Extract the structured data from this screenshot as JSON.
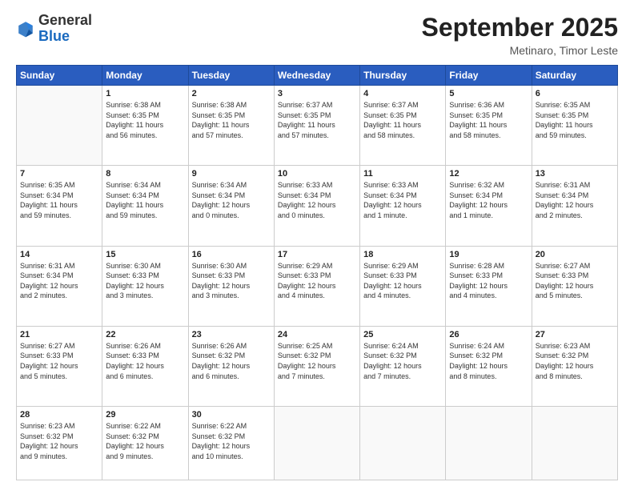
{
  "header": {
    "logo_general": "General",
    "logo_blue": "Blue",
    "month_title": "September 2025",
    "location": "Metinaro, Timor Leste"
  },
  "days_of_week": [
    "Sunday",
    "Monday",
    "Tuesday",
    "Wednesday",
    "Thursday",
    "Friday",
    "Saturday"
  ],
  "weeks": [
    [
      {
        "day": "",
        "info": ""
      },
      {
        "day": "1",
        "info": "Sunrise: 6:38 AM\nSunset: 6:35 PM\nDaylight: 11 hours\nand 56 minutes."
      },
      {
        "day": "2",
        "info": "Sunrise: 6:38 AM\nSunset: 6:35 PM\nDaylight: 11 hours\nand 57 minutes."
      },
      {
        "day": "3",
        "info": "Sunrise: 6:37 AM\nSunset: 6:35 PM\nDaylight: 11 hours\nand 57 minutes."
      },
      {
        "day": "4",
        "info": "Sunrise: 6:37 AM\nSunset: 6:35 PM\nDaylight: 11 hours\nand 58 minutes."
      },
      {
        "day": "5",
        "info": "Sunrise: 6:36 AM\nSunset: 6:35 PM\nDaylight: 11 hours\nand 58 minutes."
      },
      {
        "day": "6",
        "info": "Sunrise: 6:35 AM\nSunset: 6:35 PM\nDaylight: 11 hours\nand 59 minutes."
      }
    ],
    [
      {
        "day": "7",
        "info": "Sunrise: 6:35 AM\nSunset: 6:34 PM\nDaylight: 11 hours\nand 59 minutes."
      },
      {
        "day": "8",
        "info": "Sunrise: 6:34 AM\nSunset: 6:34 PM\nDaylight: 11 hours\nand 59 minutes."
      },
      {
        "day": "9",
        "info": "Sunrise: 6:34 AM\nSunset: 6:34 PM\nDaylight: 12 hours\nand 0 minutes."
      },
      {
        "day": "10",
        "info": "Sunrise: 6:33 AM\nSunset: 6:34 PM\nDaylight: 12 hours\nand 0 minutes."
      },
      {
        "day": "11",
        "info": "Sunrise: 6:33 AM\nSunset: 6:34 PM\nDaylight: 12 hours\nand 1 minute."
      },
      {
        "day": "12",
        "info": "Sunrise: 6:32 AM\nSunset: 6:34 PM\nDaylight: 12 hours\nand 1 minute."
      },
      {
        "day": "13",
        "info": "Sunrise: 6:31 AM\nSunset: 6:34 PM\nDaylight: 12 hours\nand 2 minutes."
      }
    ],
    [
      {
        "day": "14",
        "info": "Sunrise: 6:31 AM\nSunset: 6:34 PM\nDaylight: 12 hours\nand 2 minutes."
      },
      {
        "day": "15",
        "info": "Sunrise: 6:30 AM\nSunset: 6:33 PM\nDaylight: 12 hours\nand 3 minutes."
      },
      {
        "day": "16",
        "info": "Sunrise: 6:30 AM\nSunset: 6:33 PM\nDaylight: 12 hours\nand 3 minutes."
      },
      {
        "day": "17",
        "info": "Sunrise: 6:29 AM\nSunset: 6:33 PM\nDaylight: 12 hours\nand 4 minutes."
      },
      {
        "day": "18",
        "info": "Sunrise: 6:29 AM\nSunset: 6:33 PM\nDaylight: 12 hours\nand 4 minutes."
      },
      {
        "day": "19",
        "info": "Sunrise: 6:28 AM\nSunset: 6:33 PM\nDaylight: 12 hours\nand 4 minutes."
      },
      {
        "day": "20",
        "info": "Sunrise: 6:27 AM\nSunset: 6:33 PM\nDaylight: 12 hours\nand 5 minutes."
      }
    ],
    [
      {
        "day": "21",
        "info": "Sunrise: 6:27 AM\nSunset: 6:33 PM\nDaylight: 12 hours\nand 5 minutes."
      },
      {
        "day": "22",
        "info": "Sunrise: 6:26 AM\nSunset: 6:33 PM\nDaylight: 12 hours\nand 6 minutes."
      },
      {
        "day": "23",
        "info": "Sunrise: 6:26 AM\nSunset: 6:32 PM\nDaylight: 12 hours\nand 6 minutes."
      },
      {
        "day": "24",
        "info": "Sunrise: 6:25 AM\nSunset: 6:32 PM\nDaylight: 12 hours\nand 7 minutes."
      },
      {
        "day": "25",
        "info": "Sunrise: 6:24 AM\nSunset: 6:32 PM\nDaylight: 12 hours\nand 7 minutes."
      },
      {
        "day": "26",
        "info": "Sunrise: 6:24 AM\nSunset: 6:32 PM\nDaylight: 12 hours\nand 8 minutes."
      },
      {
        "day": "27",
        "info": "Sunrise: 6:23 AM\nSunset: 6:32 PM\nDaylight: 12 hours\nand 8 minutes."
      }
    ],
    [
      {
        "day": "28",
        "info": "Sunrise: 6:23 AM\nSunset: 6:32 PM\nDaylight: 12 hours\nand 9 minutes."
      },
      {
        "day": "29",
        "info": "Sunrise: 6:22 AM\nSunset: 6:32 PM\nDaylight: 12 hours\nand 9 minutes."
      },
      {
        "day": "30",
        "info": "Sunrise: 6:22 AM\nSunset: 6:32 PM\nDaylight: 12 hours\nand 10 minutes."
      },
      {
        "day": "",
        "info": ""
      },
      {
        "day": "",
        "info": ""
      },
      {
        "day": "",
        "info": ""
      },
      {
        "day": "",
        "info": ""
      }
    ]
  ]
}
